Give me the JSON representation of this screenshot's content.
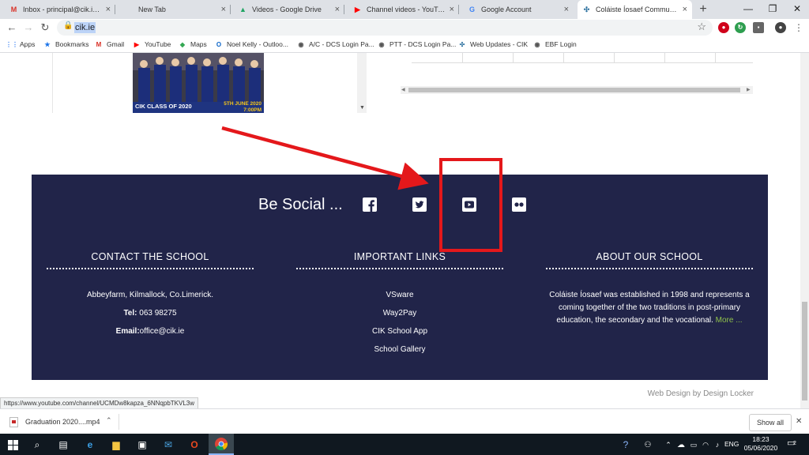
{
  "browser": {
    "tabs": [
      {
        "title": "Inbox - principal@cik.ie - Coláiste Íosaef",
        "icon": "gmail-icon",
        "glyph": "M",
        "color": "#d93025",
        "active": false
      },
      {
        "title": "New Tab",
        "icon": "new-tab-icon",
        "glyph": "",
        "color": "#dee1e6",
        "active": false
      },
      {
        "title": "Videos - Google Drive",
        "icon": "google-drive-icon",
        "glyph": "▲",
        "color": "#1fa463",
        "active": false
      },
      {
        "title": "Channel videos - YouTube Studio",
        "icon": "youtube-icon",
        "glyph": "▶",
        "color": "#ff0000",
        "active": false
      },
      {
        "title": "Google Account",
        "icon": "google-icon",
        "glyph": "G",
        "color": "#4285f4",
        "active": false
      },
      {
        "title": "Coláiste Íosaef Community College",
        "icon": "school-crest-icon",
        "glyph": "✣",
        "color": "#2a6f9e",
        "active": true
      }
    ],
    "url": "cik.ie"
  },
  "bookmarks": [
    {
      "label": "Apps",
      "icon": "apps-grid-icon",
      "glyph": "⋮⋮",
      "color": "#4285f4"
    },
    {
      "label": "Bookmarks",
      "icon": "star-icon",
      "glyph": "★",
      "color": "#1a73e8"
    },
    {
      "label": "Gmail",
      "icon": "gmail-icon",
      "glyph": "M",
      "color": "#d93025"
    },
    {
      "label": "YouTube",
      "icon": "youtube-icon",
      "glyph": "▶",
      "color": "#ff0000"
    },
    {
      "label": "Maps",
      "icon": "maps-pin-icon",
      "glyph": "◆",
      "color": "#34a853"
    },
    {
      "label": "Noel Kelly - Outloo...",
      "icon": "outlook-icon",
      "glyph": "O",
      "color": "#0a64c8"
    },
    {
      "label": "A/C - DCS Login Pa...",
      "icon": "globe-icon",
      "glyph": "◉",
      "color": "#555555"
    },
    {
      "label": "PTT - DCS Login Pa...",
      "icon": "globe-icon",
      "glyph": "◉",
      "color": "#555555"
    },
    {
      "label": "Web Updates - CIK",
      "icon": "school-crest-icon",
      "glyph": "✣",
      "color": "#2a6f9e"
    },
    {
      "label": "EBF Login",
      "icon": "globe-icon",
      "glyph": "◉",
      "color": "#555555"
    }
  ],
  "page": {
    "poster": {
      "left_text": "CIK CLASS OF 2020",
      "right_line1": "5TH JUNE 2020",
      "right_line2": "7:00PM"
    },
    "social": {
      "title": "Be Social ..."
    },
    "contact": {
      "heading": "CONTACT THE SCHOOL",
      "address": "Abbeyfarm, Kilmallock, Co.Limerick.",
      "tel_label": "Tel:",
      "tel": " 063 98275",
      "email_label": "Email:",
      "email": "office@cik.ie"
    },
    "links": {
      "heading": "IMPORTANT LINKS",
      "items": [
        "VSware",
        "Way2Pay",
        "CIK School App",
        "School Gallery"
      ]
    },
    "about": {
      "heading": "ABOUT OUR SCHOOL",
      "text": "Coláiste Íosaef was established in 1998 and represents a coming together of the two traditions in post-primary education, the secondary and the vocational.",
      "more": " More ..."
    },
    "credit": "Web Design by Design Locker"
  },
  "status_url": "https://www.youtube.com/channel/UCMDw8kapza_6NNqpbTKVL3w",
  "download": {
    "file": "Graduation 2020....mp4",
    "show_all": "Show all"
  },
  "taskbar": {
    "lang": "ENG",
    "time": "18:23",
    "date": "05/06/2020",
    "notifications": "2"
  },
  "colors": {
    "footer_bg": "#212449",
    "annotation_red": "#e4181b",
    "link_green": "#8fc14b"
  }
}
